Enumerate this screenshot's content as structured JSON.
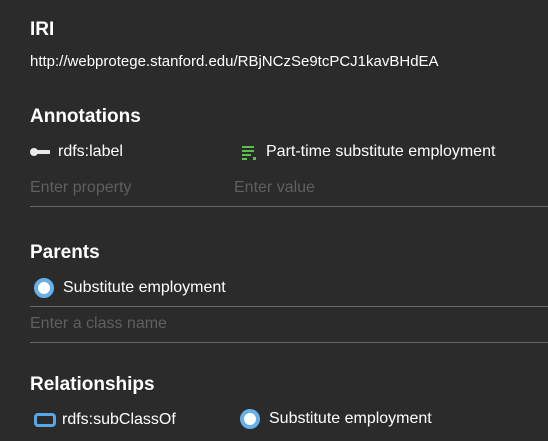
{
  "iri": {
    "title": "IRI",
    "value": "http://webprotege.stanford.edu/RBjNCzSe9tcPCJ1kavBHdEA"
  },
  "annotations": {
    "title": "Annotations",
    "property": "rdfs:label",
    "value": "Part-time substitute employment",
    "property_placeholder": "Enter property",
    "value_placeholder": "Enter value"
  },
  "parents": {
    "title": "Parents",
    "item": "Substitute employment",
    "placeholder": "Enter a class name"
  },
  "relationships": {
    "title": "Relationships",
    "property": "rdfs:subClassOf",
    "value": "Substitute employment"
  },
  "colors": {
    "background": "#2b2b2b",
    "class_icon": "#6ab0e8",
    "annotation_value_icon": "#5cc04f",
    "placeholder": "#5f5f5f"
  }
}
